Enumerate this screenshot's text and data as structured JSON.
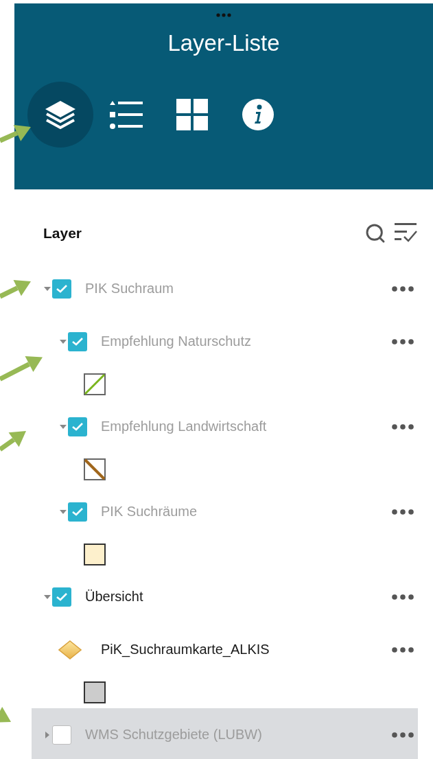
{
  "panel": {
    "title": "Layer-Liste",
    "tools": [
      {
        "kind": "layers",
        "selected": true
      },
      {
        "kind": "legend",
        "selected": false
      },
      {
        "kind": "basemap",
        "selected": false
      },
      {
        "kind": "about",
        "selected": false
      }
    ]
  },
  "layer_list": {
    "heading": "Layer",
    "items": [
      {
        "kind": "group",
        "label": "PIK Suchraum",
        "checked": true,
        "expanded": true,
        "dimmed": true,
        "selected": false,
        "children": [
          {
            "kind": "group",
            "label": "Empfehlung Naturschutz",
            "checked": true,
            "expanded": true,
            "dimmed": true,
            "selected": false,
            "children": [
              {
                "kind": "diagonal",
                "color": "#7ab51d"
              }
            ]
          },
          {
            "kind": "group",
            "label": "Empfehlung Landwirtschaft",
            "checked": true,
            "expanded": true,
            "dimmed": true,
            "selected": false,
            "children": [
              {
                "kind": "antidiagonal",
                "color": "#a0661c"
              }
            ]
          },
          {
            "kind": "group",
            "label": "PIK Suchräume",
            "checked": true,
            "expanded": true,
            "dimmed": true,
            "selected": false,
            "children": [
              {
                "kind": "fill",
                "color": "#fdf0cc"
              }
            ]
          }
        ]
      },
      {
        "kind": "group",
        "label": "Übersicht",
        "checked": true,
        "expanded": true,
        "dimmed": false,
        "selected": false,
        "children": [
          {
            "kind": "feature",
            "label": "PiK_Suchraumkarte_ALKIS",
            "dimmed": false,
            "selected": false,
            "children": [
              {
                "kind": "fill",
                "color": "#cccccc"
              }
            ]
          }
        ]
      },
      {
        "kind": "group",
        "label": "WMS Schutzgebiete (LUBW)",
        "checked": false,
        "expanded": false,
        "dimmed": true,
        "selected": true
      }
    ]
  }
}
